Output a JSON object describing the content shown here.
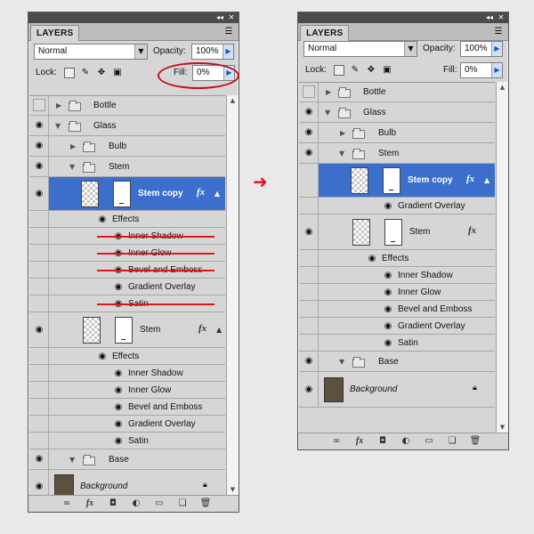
{
  "panel_tab": "LAYERS",
  "blend_mode": "Normal",
  "opacity_label": "Opacity:",
  "opacity_value": "100%",
  "lock_label": "Lock:",
  "fill_label": "Fill:",
  "fill_value": "0%",
  "icons": {
    "collapse": "collapse-double-arrow-icon",
    "close": "close-icon",
    "panel_menu": "panel-menu-icon",
    "eye": "eye-icon",
    "folder": "folder-icon",
    "fx": "fx-icon",
    "lock": "lock-icon"
  },
  "colors": {
    "selection": "#3c6fcc",
    "annotation_red": "#e4121d",
    "background_swatch": "#5d5040"
  },
  "labels": {
    "fx": "fx",
    "bottle": "Bottle",
    "glass": "Glass",
    "bulb": "Bulb",
    "stem": "Stem",
    "stem_copy": "Stem copy",
    "effects": "Effects",
    "inner_shadow": "Inner Shadow",
    "inner_glow": "Inner Glow",
    "bevel_emboss": "Bevel and Emboss",
    "gradient_overlay": "Gradient Overlay",
    "satin": "Satin",
    "base": "Base",
    "background": "Background"
  }
}
